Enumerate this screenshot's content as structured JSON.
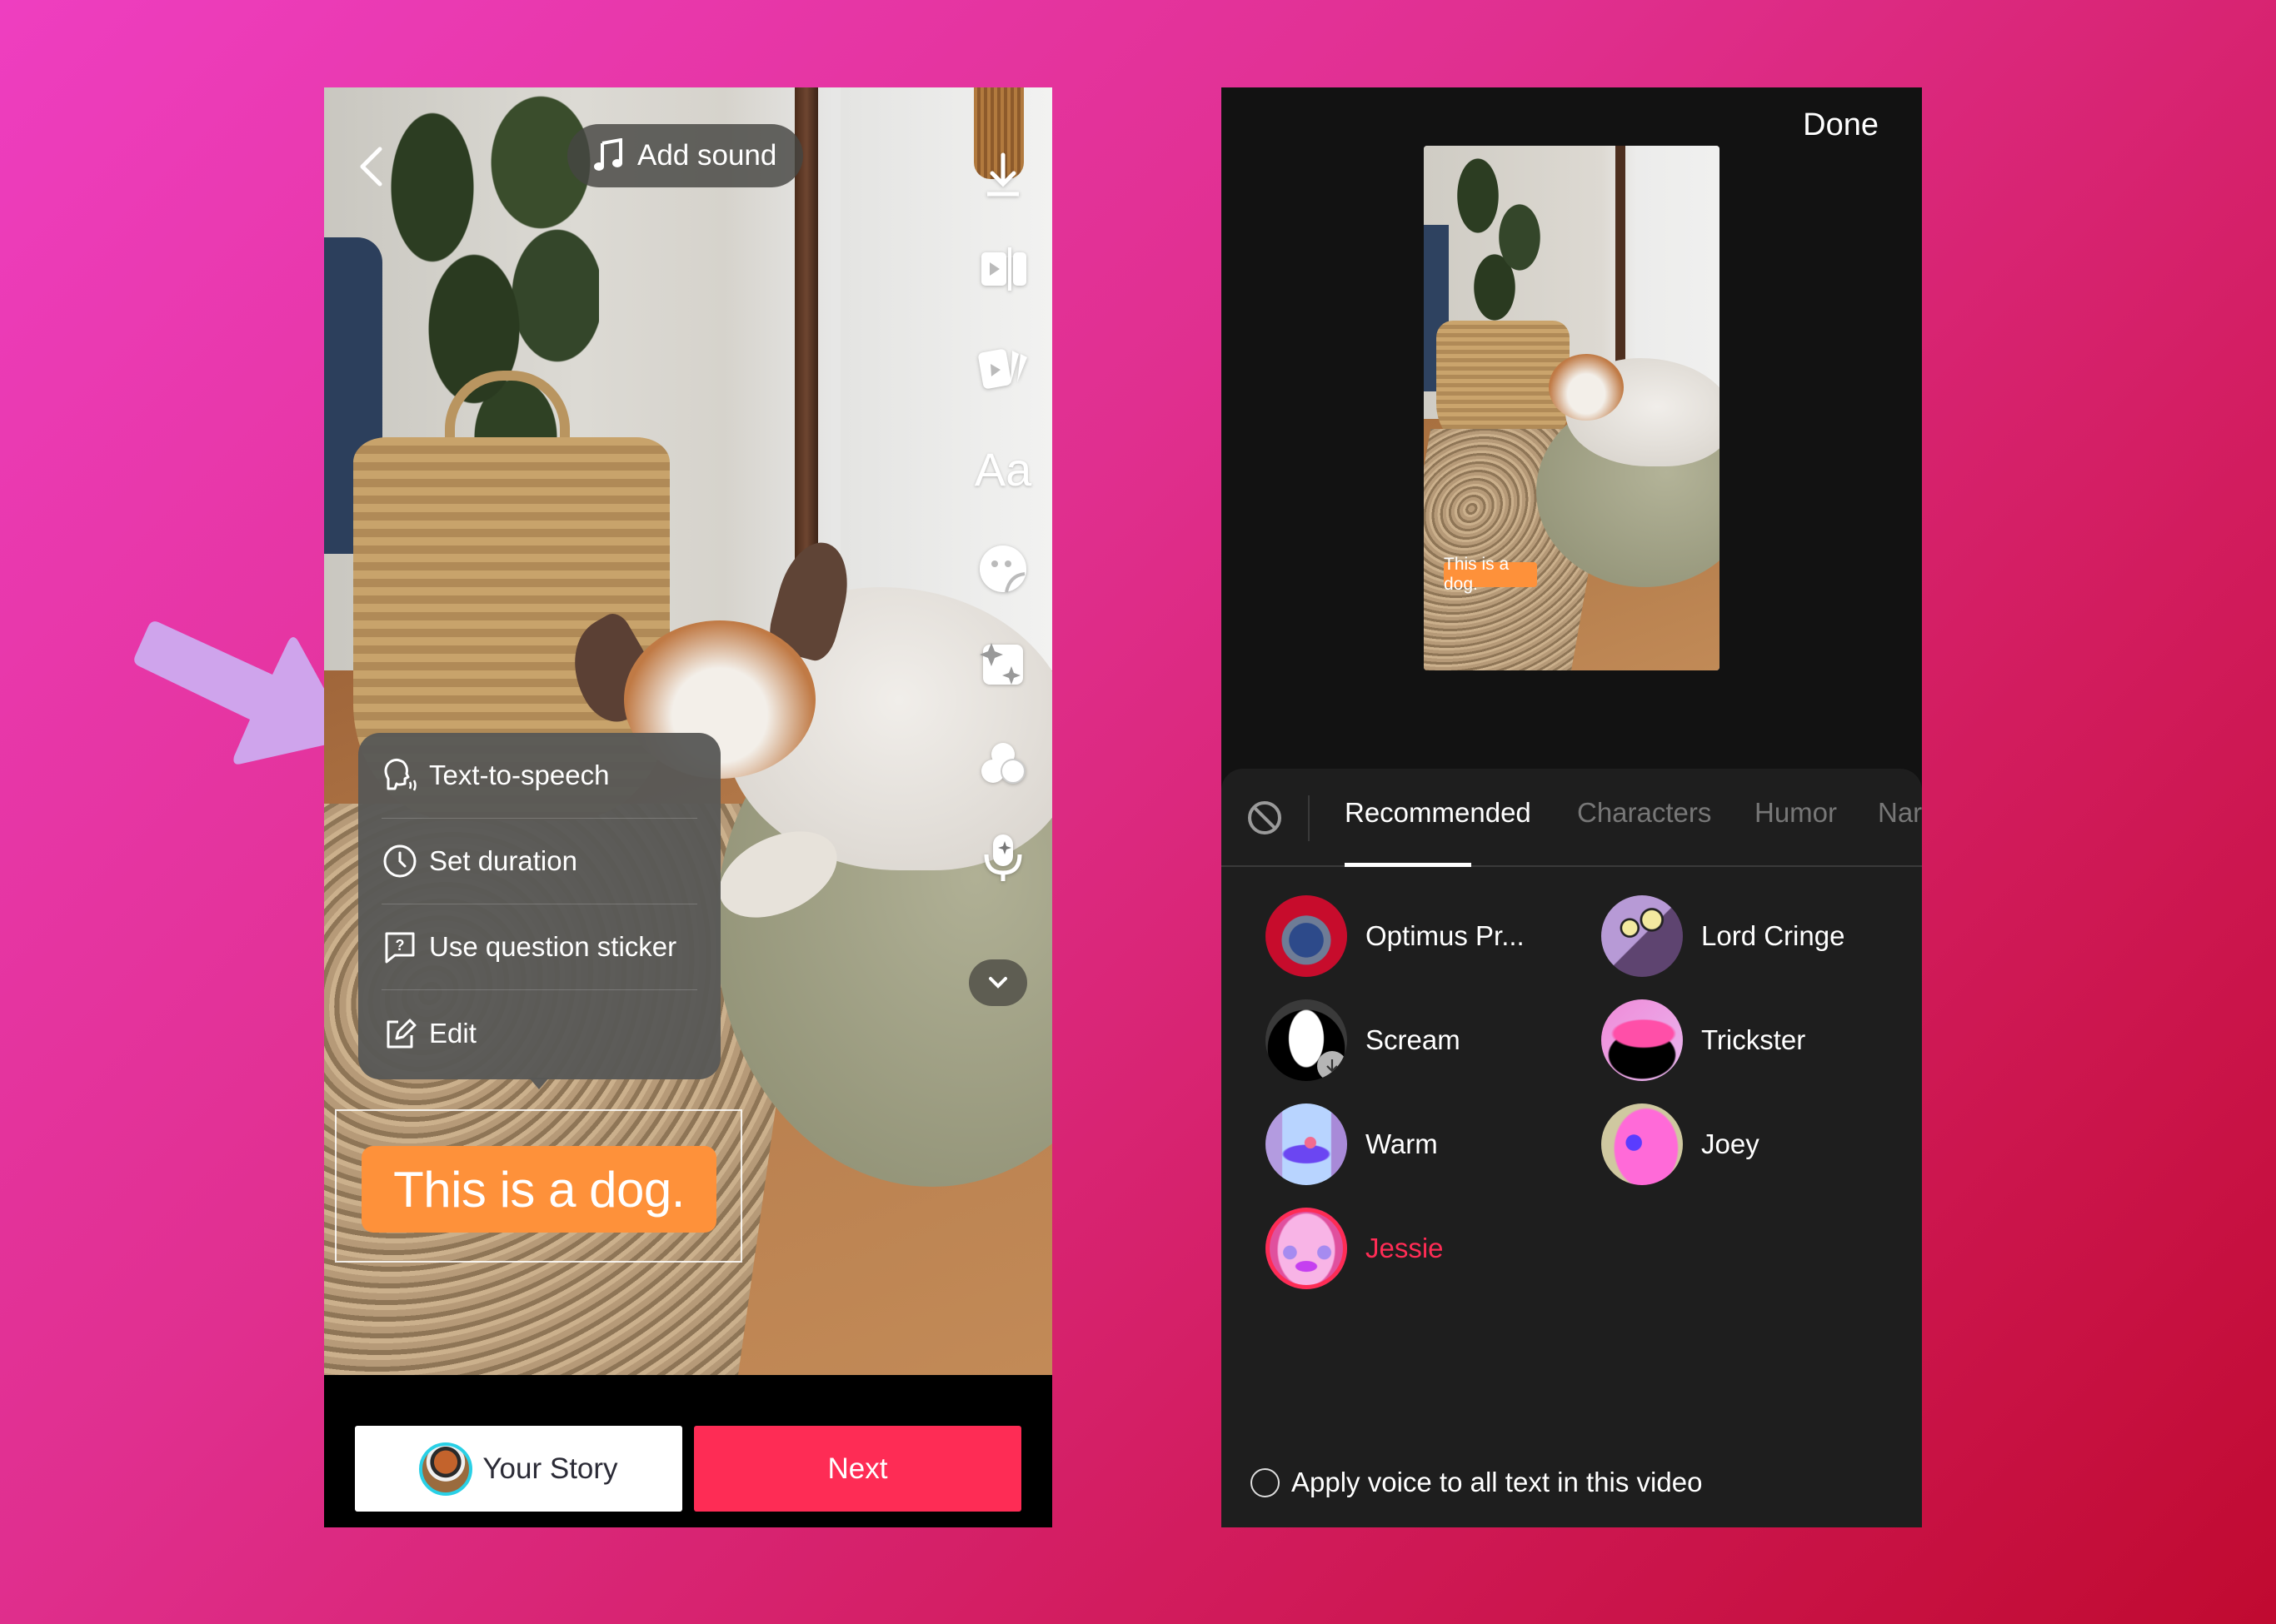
{
  "colors": {
    "brand_red": "#fe2c55",
    "sticker_orange": "#fe913a",
    "arrow_lavender": "#cfa4ec",
    "sheet_bg": "#1e1e1e"
  },
  "editor": {
    "back_icon": "chevron-left-icon",
    "add_sound_label": "Add sound",
    "side_tools": [
      {
        "icon": "download-icon"
      },
      {
        "icon": "trim-clip-icon"
      },
      {
        "icon": "templates-icon"
      },
      {
        "icon": "text-icon",
        "label": "Aa"
      },
      {
        "icon": "sticker-icon"
      },
      {
        "icon": "effects-icon"
      },
      {
        "icon": "filters-icon"
      },
      {
        "icon": "voice-effects-icon"
      },
      {
        "icon": "chevron-down-icon"
      }
    ],
    "context_menu": [
      {
        "icon": "text-to-speech-icon",
        "label": "Text-to-speech"
      },
      {
        "icon": "clock-icon",
        "label": "Set duration"
      },
      {
        "icon": "question-sticker-icon",
        "label": "Use question sticker"
      },
      {
        "icon": "edit-icon",
        "label": "Edit"
      }
    ],
    "text_sticker": "This is a dog.",
    "your_story_label": "Your Story",
    "next_label": "Next"
  },
  "voice_picker": {
    "done_label": "Done",
    "preview_sticker": "This is a dog.",
    "tabs": [
      {
        "label": "Recommended",
        "active": true
      },
      {
        "label": "Characters",
        "active": false
      },
      {
        "label": "Humor",
        "active": false
      },
      {
        "label": "Nar",
        "active": false
      }
    ],
    "voices": [
      {
        "name": "Optimus Pr...",
        "selected": false,
        "downloadable": false
      },
      {
        "name": "Lord Cringe",
        "selected": false,
        "downloadable": false
      },
      {
        "name": "Scream",
        "selected": false,
        "downloadable": true
      },
      {
        "name": "Trickster",
        "selected": false,
        "downloadable": false
      },
      {
        "name": "Warm",
        "selected": false,
        "downloadable": false
      },
      {
        "name": "Joey",
        "selected": false,
        "downloadable": false
      },
      {
        "name": "Jessie",
        "selected": true,
        "downloadable": false
      }
    ],
    "apply_all_label": "Apply voice to all text in this video",
    "apply_all_checked": false
  }
}
